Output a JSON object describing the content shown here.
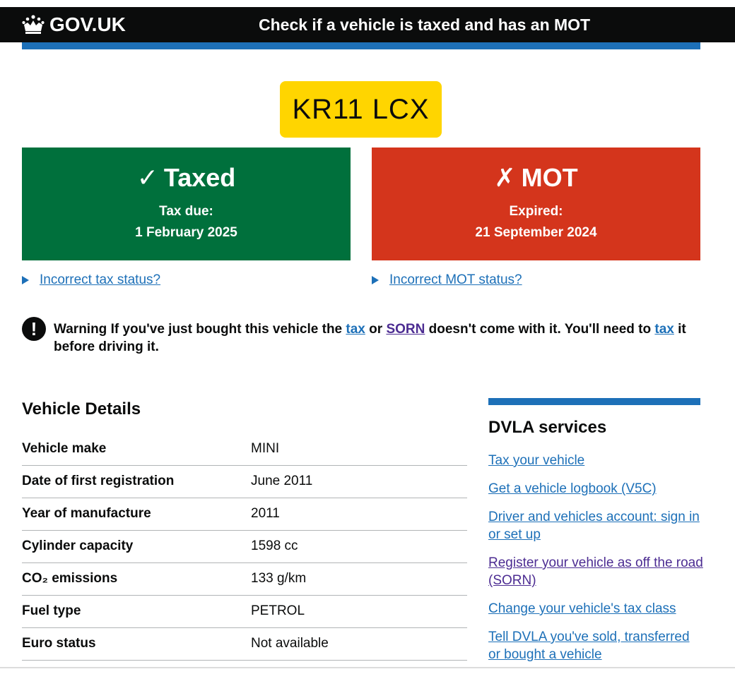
{
  "header": {
    "logo_text": "GOV.UK",
    "service_name": "Check if a vehicle is taxed and has an MOT"
  },
  "registration": "KR11 LCX",
  "tax_panel": {
    "mark": "✓",
    "title": "Taxed",
    "label": "Tax due:",
    "date": "1 February 2025",
    "color": "#00703c"
  },
  "mot_panel": {
    "mark": "✗",
    "title": "MOT",
    "label": "Expired:",
    "date": "21 September 2024",
    "color": "#d4351c"
  },
  "links": {
    "incorrect_tax": "Incorrect tax status?",
    "incorrect_mot": "Incorrect MOT status?"
  },
  "warning": {
    "icon": "!",
    "part1": "Warning If you've just bought this vehicle the ",
    "link_tax": "tax",
    "part2": " or ",
    "link_sorn": "SORN",
    "part3": " doesn't come with it. You'll need to ",
    "link_tax2": "tax",
    "part4": " it before driving it."
  },
  "vehicle_details": {
    "heading": "Vehicle Details",
    "rows": [
      {
        "label": "Vehicle make",
        "value": "MINI"
      },
      {
        "label": "Date of first registration",
        "value": "June 2011"
      },
      {
        "label": "Year of manufacture",
        "value": "2011"
      },
      {
        "label": "Cylinder capacity",
        "value": "1598 cc"
      },
      {
        "label": "CO₂ emissions",
        "value": "133 g/km"
      },
      {
        "label": "Fuel type",
        "value": "PETROL"
      },
      {
        "label": "Euro status",
        "value": "Not available"
      }
    ]
  },
  "dvla_services": {
    "heading": "DVLA services",
    "items": [
      {
        "label": "Tax your vehicle"
      },
      {
        "label": "Get a vehicle logbook (V5C)"
      },
      {
        "label": "Driver and vehicles account: sign in or set up"
      },
      {
        "label": "Register your vehicle as off the road (SORN)"
      },
      {
        "label": "Change your vehicle's tax class"
      },
      {
        "label": "Tell DVLA you've sold, transferred or bought a vehicle"
      }
    ]
  },
  "colors": {
    "brand_blue": "#1d70b8",
    "link_visited": "#4c2c92",
    "plate_yellow": "#ffd500",
    "header_black": "#0b0c0c"
  }
}
